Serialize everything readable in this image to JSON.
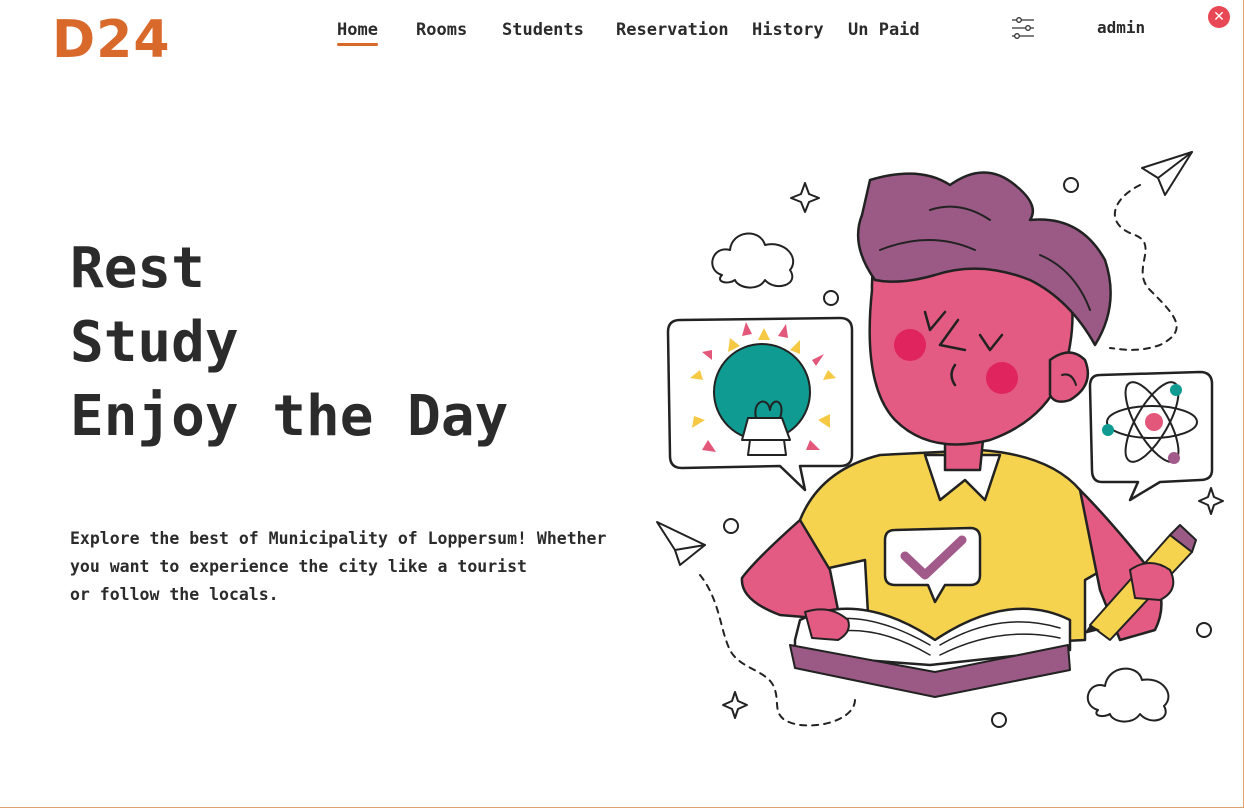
{
  "brand": {
    "logo": "D24",
    "accent": "#d9692b"
  },
  "nav": {
    "items": [
      {
        "label": "Home",
        "active": true
      },
      {
        "label": "Rooms"
      },
      {
        "label": "Students"
      },
      {
        "label": "Reservation"
      },
      {
        "label": "History"
      },
      {
        "label": "Un Paid"
      }
    ]
  },
  "header": {
    "settings_icon": "sliders-icon",
    "user": "admin",
    "close_icon": "close-icon",
    "close_color": "#e84855"
  },
  "hero": {
    "title_lines": [
      "Rest",
      "Study",
      "Enjoy the Day"
    ],
    "description_lines": [
      "Explore the best of Municipality of Loppersum! Whether",
      "you want to experience the city like a tourist",
      "or follow the locals."
    ]
  },
  "illustration": {
    "name": "student-studying-illustration"
  }
}
